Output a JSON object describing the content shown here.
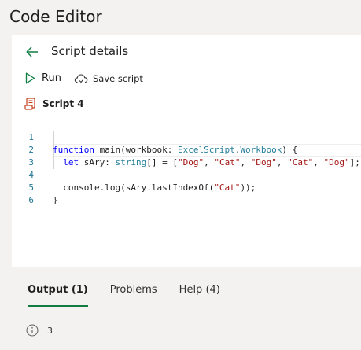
{
  "app": {
    "title": "Code Editor"
  },
  "header": {
    "title": "Script details"
  },
  "toolbar": {
    "run_label": "Run",
    "save_label": "Save script"
  },
  "script": {
    "name": "Script 4"
  },
  "editor": {
    "line_numbers": [
      "1",
      "2",
      "3",
      "4",
      "5",
      "6"
    ],
    "lines": [
      "function main(workbook: ExcelScript.Workbook) {",
      "  let sAry: string[] = [\"Dog\", \"Cat\", \"Dog\", \"Cat\", \"Dog\"];",
      "",
      "  console.log(sAry.lastIndexOf(\"Cat\"));",
      "}",
      ""
    ]
  },
  "output_tabs": [
    {
      "label": "Output (1)",
      "active": true
    },
    {
      "label": "Problems",
      "active": false
    },
    {
      "label": "Help (4)",
      "active": false
    }
  ],
  "output": {
    "value": "3"
  },
  "colors": {
    "run_green": "#107c41",
    "line_number": "#237893",
    "keyword": "#0000ff",
    "string": "#a31515",
    "type": "#267f99"
  },
  "icons": {
    "back": "arrow-left-icon",
    "run": "play-icon",
    "save": "cloud-save-icon",
    "script": "script-icon",
    "info": "info-icon"
  }
}
